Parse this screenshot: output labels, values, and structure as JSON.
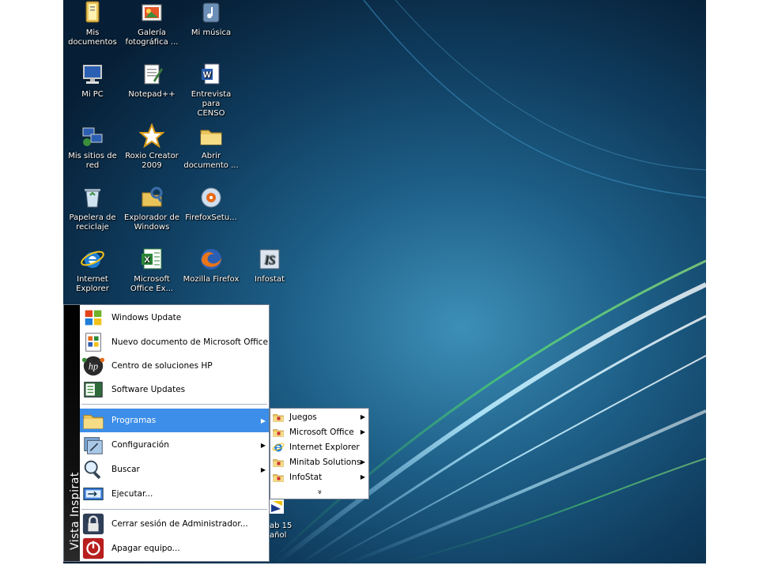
{
  "desktop_icons": [
    {
      "label": "Mis\ndocumentos",
      "icon": "folder-documents-icon"
    },
    {
      "label": "Galería\nfotográfica ...",
      "icon": "photo-gallery-icon"
    },
    {
      "label": "Mi música",
      "icon": "music-folder-icon"
    },
    {
      "label": "Mi PC",
      "icon": "computer-icon"
    },
    {
      "label": "Notepad++",
      "icon": "notepad-icon"
    },
    {
      "label": "Entrevista para\nCENSO",
      "icon": "word-document-icon"
    },
    {
      "label": "Mis sitios de\nred",
      "icon": "network-places-icon"
    },
    {
      "label": "Roxio Creator\n2009",
      "icon": "roxio-star-icon"
    },
    {
      "label": "Abrir\ndocumento ...",
      "icon": "open-document-folder-icon"
    },
    {
      "label": "Papelera de\nreciclaje",
      "icon": "recycle-bin-icon"
    },
    {
      "label": "Explorador de\nWindows",
      "icon": "windows-explorer-icon"
    },
    {
      "label": "FirefoxSetu...",
      "icon": "firefox-setup-icon"
    },
    {
      "label": "Internet\nExplorer",
      "icon": "internet-explorer-icon"
    },
    {
      "label": "Microsoft\nOffice Ex...",
      "icon": "excel-icon"
    },
    {
      "label": "Mozilla Firefox",
      "icon": "firefox-icon"
    },
    {
      "label": "Infostat",
      "icon": "infostat-icon"
    }
  ],
  "start_menu": {
    "sidebar_text": "Vista Inspirat",
    "pinned": [
      {
        "label": "Windows Update",
        "icon": "windows-update-icon"
      },
      {
        "label": "Nuevo documento de Microsoft Office",
        "icon": "new-office-document-icon"
      },
      {
        "label": "Centro de soluciones HP",
        "icon": "hp-solution-center-icon"
      },
      {
        "label": "Software Updates",
        "icon": "software-updates-icon"
      }
    ],
    "main": [
      {
        "label": "Programas",
        "icon": "programs-folder-icon",
        "has_submenu": true,
        "selected": true
      },
      {
        "label": "Configuración",
        "icon": "settings-icon",
        "has_submenu": true
      },
      {
        "label": "Buscar",
        "icon": "search-icon",
        "has_submenu": true
      },
      {
        "label": "Ejecutar...",
        "icon": "run-icon",
        "has_submenu": false
      }
    ],
    "bottom": [
      {
        "label": "Cerrar sesión de Administrador...",
        "icon": "logoff-lock-icon"
      },
      {
        "label": "Apagar equipo...",
        "icon": "power-icon"
      }
    ]
  },
  "programs_submenu": {
    "items": [
      {
        "label": "Juegos",
        "icon": "program-group-folder-icon",
        "has_submenu": true
      },
      {
        "label": "Microsoft Office",
        "icon": "program-group-folder-icon",
        "has_submenu": true
      },
      {
        "label": "Internet Explorer",
        "icon": "internet-explorer-icon",
        "has_submenu": false
      },
      {
        "label": "Minitab Solutions",
        "icon": "program-group-folder-icon",
        "has_submenu": true
      },
      {
        "label": "InfoStat",
        "icon": "program-group-folder-icon",
        "has_submenu": true
      }
    ],
    "expand_glyph": "»"
  },
  "partially_hidden_icon": {
    "label": "ab 15\nañol"
  },
  "colors": {
    "selection": "#3d8ee8",
    "desktop_dark": "#0f3c5e",
    "sidebar": "#000000"
  }
}
